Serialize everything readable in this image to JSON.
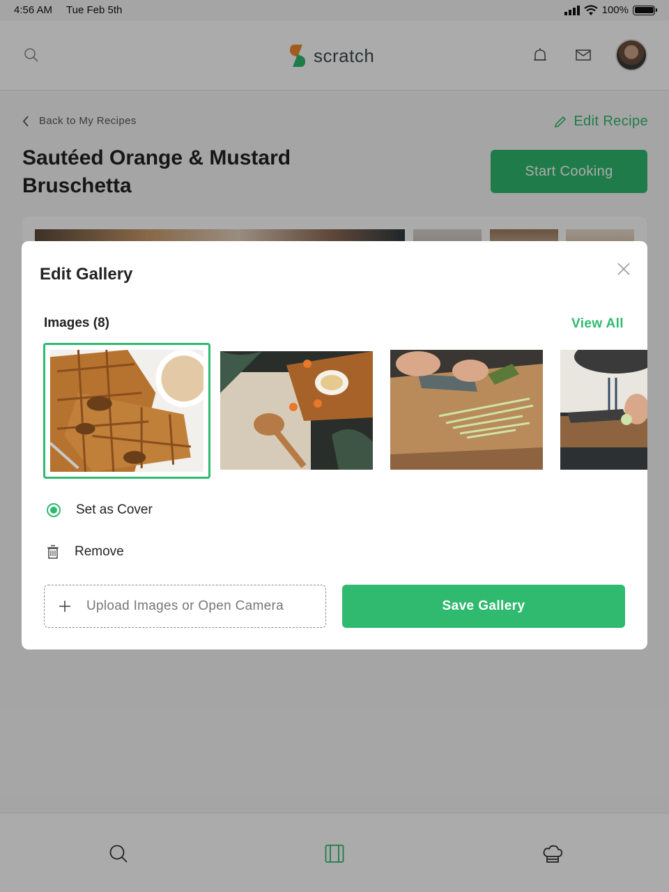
{
  "status": {
    "time": "4:56 AM",
    "date": "Tue Feb 5th",
    "battery": "100%"
  },
  "header": {
    "brand": "scratch",
    "icons": [
      "search-icon",
      "bell-icon",
      "mail-icon"
    ]
  },
  "page": {
    "back_label": "Back to My Recipes",
    "edit_label": "Edit Recipe",
    "title": "Sautéed Orange & Mustard Bruschetta",
    "start_label": "Start Cooking"
  },
  "modal": {
    "title": "Edit Gallery",
    "images_label": "Images (8)",
    "view_all": "View All",
    "images": [
      {
        "name": "waffles",
        "selected": true
      },
      {
        "name": "turmeric-spoon",
        "selected": false
      },
      {
        "name": "slicing-cucumber",
        "selected": false
      },
      {
        "name": "chef-cutting",
        "selected": false
      }
    ],
    "set_cover_label": "Set as Cover",
    "remove_label": "Remove",
    "upload_label": "Upload Images or Open Camera",
    "save_label": "Save Gallery"
  },
  "bottom_nav": [
    "search-icon",
    "recipes-icon",
    "chef-hat-icon"
  ],
  "colors": {
    "accent": "#2fba6f",
    "text": "#222222"
  }
}
